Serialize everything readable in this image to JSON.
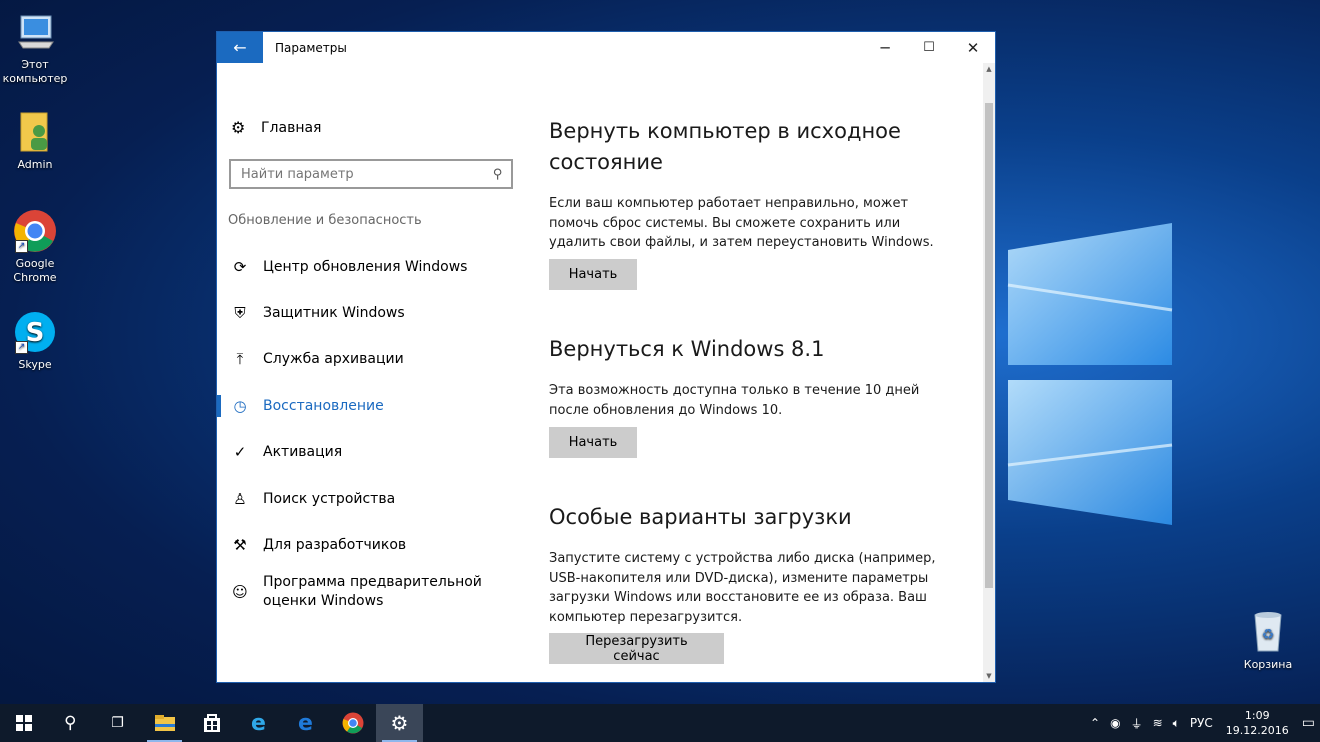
{
  "desktop": {
    "icons": [
      {
        "label": "Этот компьютер",
        "icon": "computer-icon"
      },
      {
        "label": "Admin",
        "icon": "user-folder-icon"
      },
      {
        "label": "Google Chrome",
        "icon": "chrome-icon"
      },
      {
        "label": "Skype",
        "icon": "skype-icon"
      },
      {
        "label": "Корзина",
        "icon": "recycle-bin-icon"
      }
    ]
  },
  "window": {
    "title": "Параметры",
    "controls": {
      "minimize": "─",
      "maximize": "☐",
      "close": "✕"
    },
    "accent": "#1b6ac0"
  },
  "sidebar": {
    "home_label": "Главная",
    "search_placeholder": "Найти параметр",
    "section_header": "Обновление и безопасность",
    "items": [
      {
        "label": "Центр обновления Windows",
        "icon": "refresh-icon"
      },
      {
        "label": "Защитник Windows",
        "icon": "shield-icon"
      },
      {
        "label": "Служба архивации",
        "icon": "backup-arrow-icon"
      },
      {
        "label": "Восстановление",
        "icon": "history-icon",
        "active": true
      },
      {
        "label": "Активация",
        "icon": "check-circle-icon"
      },
      {
        "label": "Поиск устройства",
        "icon": "find-device-icon"
      },
      {
        "label": "Для разработчиков",
        "icon": "developer-tools-icon"
      },
      {
        "label": "Программа предварительной оценки Windows",
        "icon": "insider-icon"
      }
    ]
  },
  "content": {
    "sections": [
      {
        "heading": "Вернуть компьютер в исходное состояние",
        "text": "Если ваш компьютер работает неправильно, может помочь сброс системы. Вы сможете сохранить или удалить свои файлы, и затем переустановить Windows.",
        "button": "Начать"
      },
      {
        "heading": "Вернуться к Windows 8.1",
        "text": "Эта возможность доступна только в течение 10 дней после обновления до Windows 10.",
        "button": "Начать"
      },
      {
        "heading": "Особые варианты загрузки",
        "text": "Запустите систему с устройства либо диска (например, USB-накопителя или DVD-диска), измените параметры загрузки Windows или восстановите ее из образа. Ваш компьютер перезагрузится.",
        "button": "Перезагрузить сейчас"
      }
    ]
  },
  "taskbar": {
    "items": [
      "start-icon",
      "search-icon",
      "task-view-icon",
      "file-explorer-icon",
      "store-icon",
      "internet-explorer-icon",
      "edge-icon",
      "chrome-icon",
      "settings-icon"
    ],
    "tray": {
      "language": "РУС",
      "time": "1:09",
      "date": "19.12.2016"
    }
  }
}
